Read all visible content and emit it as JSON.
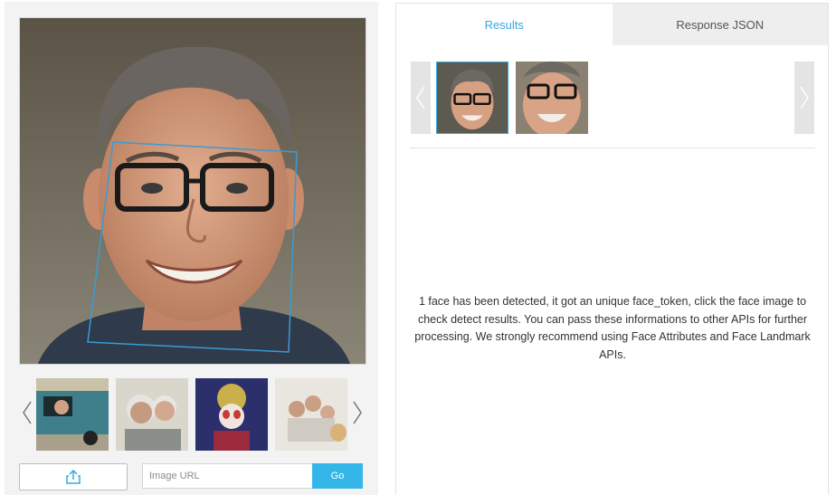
{
  "left_panel": {
    "main_image_alt": "Portrait photo of a smiling man with glasses",
    "thumbnails": [
      {
        "icon": "photo-truck-person"
      },
      {
        "icon": "photo-elderly-couple"
      },
      {
        "icon": "photo-opera-performer"
      },
      {
        "icon": "photo-family-dog"
      }
    ],
    "upload_icon": "share-upload-icon",
    "url_input": {
      "placeholder": "Image URL",
      "value": ""
    },
    "go_label": "Go"
  },
  "right_panel": {
    "tabs": [
      {
        "label": "Results",
        "active": true
      },
      {
        "label": "Response JSON",
        "active": false
      }
    ],
    "faces": [
      {
        "icon": "face-crop-1",
        "selected": true
      },
      {
        "icon": "face-crop-2",
        "selected": false
      }
    ],
    "message": "1 face has been detected, it got an unique face_token, click the face image to check detect results. You can pass these informations to other APIs for further processing. We strongly recommend using Face Attributes and Face Landmark APIs."
  },
  "colors": {
    "accent": "#35a8e0",
    "go_button": "#35b6e8",
    "face_box": "#3a9bd5",
    "panel_bg": "#f3f3f3"
  }
}
